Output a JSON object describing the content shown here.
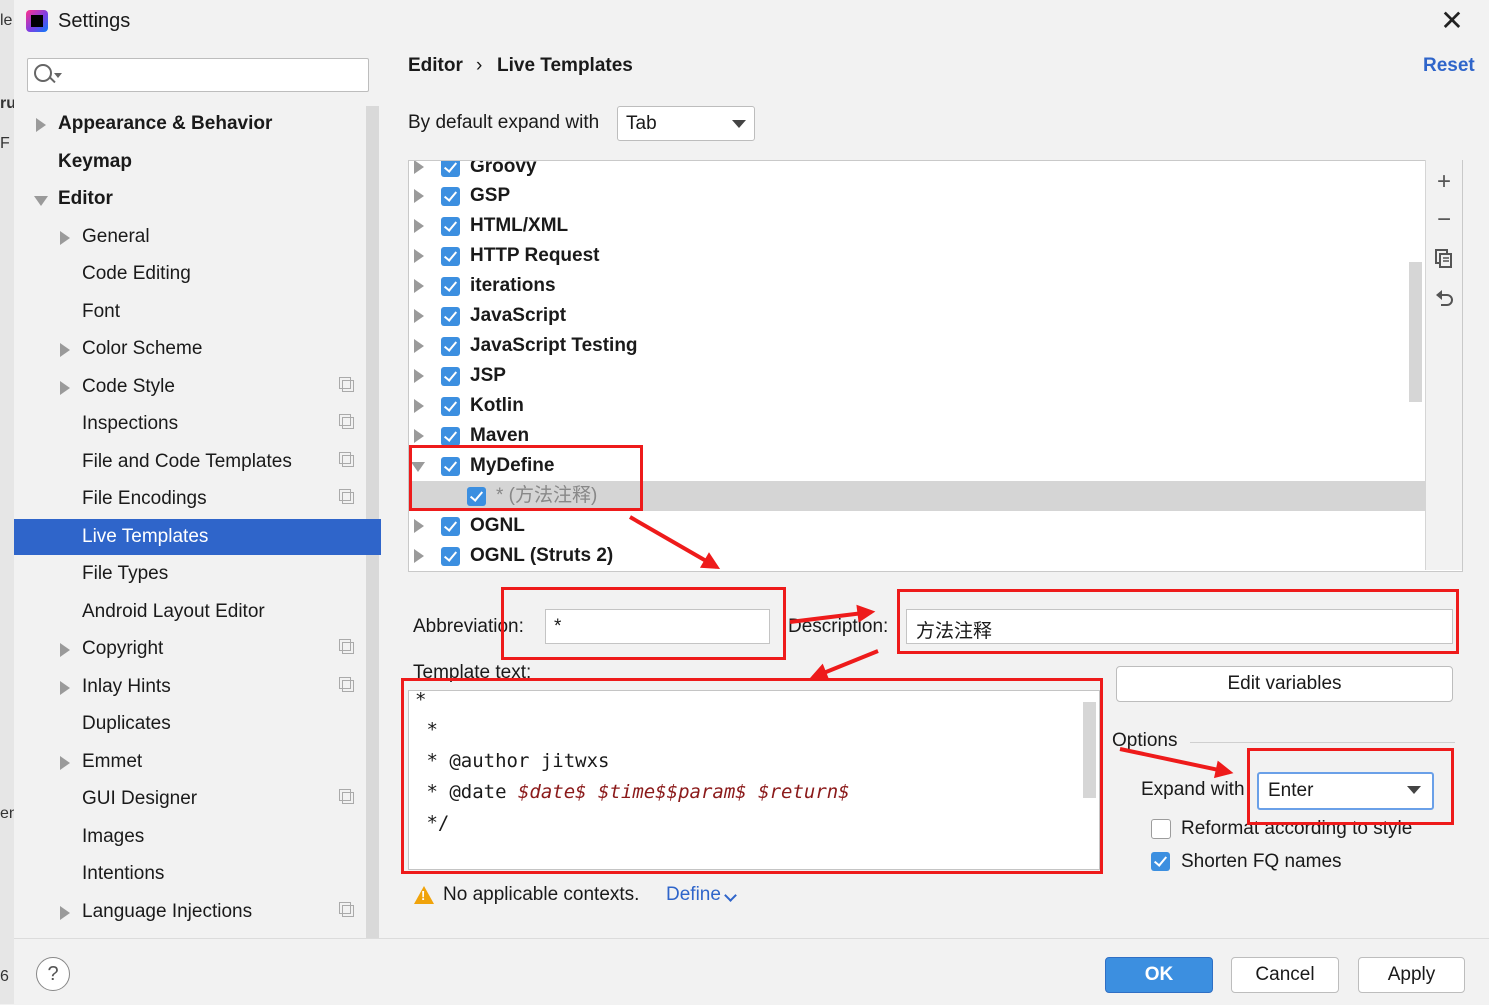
{
  "window": {
    "title": "Settings"
  },
  "background_window": {
    "fragments": [
      "le",
      "ru",
      "F",
      "en",
      "6"
    ]
  },
  "search": {
    "value": "",
    "placeholder": ""
  },
  "sidebar": {
    "items": [
      {
        "label": "Appearance & Behavior"
      },
      {
        "label": "Keymap"
      },
      {
        "label": "Editor"
      },
      {
        "label": "General"
      },
      {
        "label": "Code Editing"
      },
      {
        "label": "Font"
      },
      {
        "label": "Color Scheme"
      },
      {
        "label": "Code Style"
      },
      {
        "label": "Inspections"
      },
      {
        "label": "File and Code Templates"
      },
      {
        "label": "File Encodings"
      },
      {
        "label": "Live Templates"
      },
      {
        "label": "File Types"
      },
      {
        "label": "Android Layout Editor"
      },
      {
        "label": "Copyright"
      },
      {
        "label": "Inlay Hints"
      },
      {
        "label": "Duplicates"
      },
      {
        "label": "Emmet"
      },
      {
        "label": "GUI Designer"
      },
      {
        "label": "Images"
      },
      {
        "label": "Intentions"
      },
      {
        "label": "Language Injections"
      }
    ],
    "selected": "Live Templates"
  },
  "header": {
    "breadcrumb": [
      "Editor",
      "Live Templates"
    ],
    "separator": "›",
    "reset_label": "Reset"
  },
  "expand_default": {
    "label": "By default expand with",
    "value": "Tab"
  },
  "templates": {
    "groups": [
      {
        "name": "Groovy",
        "checked": true
      },
      {
        "name": "GSP",
        "checked": true
      },
      {
        "name": "HTML/XML",
        "checked": true
      },
      {
        "name": "HTTP Request",
        "checked": true
      },
      {
        "name": "iterations",
        "checked": true
      },
      {
        "name": "JavaScript",
        "checked": true
      },
      {
        "name": "JavaScript Testing",
        "checked": true
      },
      {
        "name": "JSP",
        "checked": true
      },
      {
        "name": "Kotlin",
        "checked": true
      },
      {
        "name": "Maven",
        "checked": true
      },
      {
        "name": "MyDefine",
        "checked": true,
        "expanded": true
      },
      {
        "name": "* (方法注释)",
        "checked": true,
        "child": true,
        "selected": true
      },
      {
        "name": "OGNL",
        "checked": true
      },
      {
        "name": "OGNL (Struts 2)",
        "checked": true
      }
    ],
    "toolbar_icons": [
      "plus-icon",
      "minus-icon",
      "copy-icon",
      "restore-icon"
    ]
  },
  "form": {
    "abbreviation_label": "Abbreviation:",
    "abbreviation_value": "*",
    "description_label": "Description:",
    "description_value": "方法注释",
    "template_text_label": "Template text:",
    "template_lines": [
      {
        "plain": "*",
        "vars": ""
      },
      {
        "plain": " *",
        "vars": ""
      },
      {
        "plain": " * @author jitwxs",
        "vars": ""
      },
      {
        "plain": " * @date ",
        "vars": "$date$ $time$$param$ $return$"
      },
      {
        "plain": " */",
        "vars": ""
      }
    ],
    "edit_variables_label": "Edit variables",
    "options_label": "Options",
    "expand_with_label": "Expand with",
    "expand_with_value": "Enter",
    "reformat_label": "Reformat according to style",
    "reformat_checked": false,
    "shorten_label": "Shorten FQ names",
    "shorten_checked": true,
    "warning_text": "No applicable contexts.",
    "define_label": "Define"
  },
  "buttons": {
    "ok": "OK",
    "cancel": "Cancel",
    "apply": "Apply",
    "help": "?"
  },
  "colors": {
    "accent": "#2f65ca",
    "checkbox": "#3c8fe0",
    "annotation": "#ee1b1b",
    "variable": "#8b1a1a"
  }
}
